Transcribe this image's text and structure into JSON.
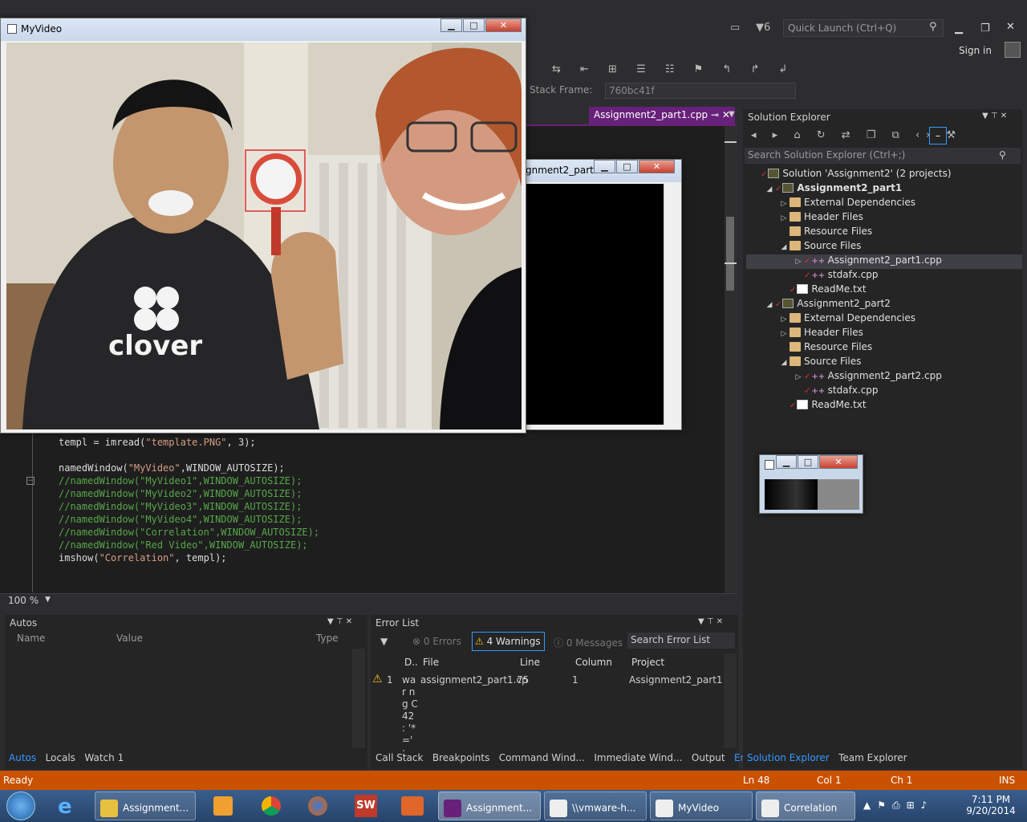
{
  "vs": {
    "quick_launch_placeholder": "Quick Launch (Ctrl+Q)",
    "notifications_count": "6",
    "sign_in": "Sign in",
    "stack_frame_label": "Stack Frame:",
    "stack_frame_value": "760bc41f",
    "doc_tab": "Assignment2_part1.cpp",
    "zoom": "100 %"
  },
  "code_lines": [
    {
      "text": "templ = imread(",
      "str": "\"template.PNG\"",
      "tail": ", 3);",
      "comment": false
    },
    {
      "text": "",
      "str": "",
      "tail": "",
      "comment": false
    },
    {
      "text": "namedWindow(",
      "str": "\"MyVideo\"",
      "tail": ",WINDOW_AUTOSIZE);",
      "comment": false
    },
    {
      "text": "//namedWindow(\"MyVideo1\",WINDOW_AUTOSIZE);",
      "str": "",
      "tail": "",
      "comment": true
    },
    {
      "text": "//namedWindow(\"MyVideo2\",WINDOW_AUTOSIZE);",
      "str": "",
      "tail": "",
      "comment": true
    },
    {
      "text": "//namedWindow(\"MyVideo3\",WINDOW_AUTOSIZE);",
      "str": "",
      "tail": "",
      "comment": true
    },
    {
      "text": "//namedWindow(\"MyVideo4\",WINDOW_AUTOSIZE);",
      "str": "",
      "tail": "",
      "comment": true
    },
    {
      "text": "//namedWindow(\"Correlation\",WINDOW_AUTOSIZE);",
      "str": "",
      "tail": "",
      "comment": true
    },
    {
      "text": "//namedWindow(\"Red Video\",WINDOW_AUTOSIZE);",
      "str": "",
      "tail": "",
      "comment": true
    },
    {
      "text": "imshow(",
      "str": "\"Correlation\"",
      "tail": ", templ);",
      "comment": false
    }
  ],
  "autos": {
    "title": "Autos",
    "columns": [
      "Name",
      "Value",
      "Type"
    ],
    "tabs": [
      "Autos",
      "Locals",
      "Watch 1"
    ]
  },
  "error_list": {
    "title": "Error List",
    "errors": "0 Errors",
    "warnings": "4 Warnings",
    "messages": "0 Messages",
    "search_placeholder": "Search Error List",
    "columns": [
      "D..",
      "File",
      "Line",
      "Column",
      "Project"
    ],
    "row": {
      "num": "1",
      "desc": "war ng C42 : '*=' :",
      "file": "assignment2_part1.cp",
      "line": "75",
      "column": "1",
      "project": "Assignment2_part1"
    },
    "tabs": [
      "Call Stack",
      "Breakpoints",
      "Command Wind...",
      "Immediate Wind...",
      "Output",
      "Error List"
    ]
  },
  "solution_explorer": {
    "title": "Solution Explorer",
    "search_placeholder": "Search Solution Explorer (Ctrl+;)",
    "items": [
      {
        "label": "Solution 'Assignment2' (2 projects)",
        "type": "solution"
      },
      {
        "label": "Assignment2_part1",
        "type": "project"
      },
      {
        "label": "External Dependencies",
        "type": "folder"
      },
      {
        "label": "Header Files",
        "type": "folder"
      },
      {
        "label": "Resource Files",
        "type": "folder"
      },
      {
        "label": "Source Files",
        "type": "folder"
      },
      {
        "label": "Assignment2_part1.cpp",
        "type": "cpp"
      },
      {
        "label": "stdafx.cpp",
        "type": "cpp"
      },
      {
        "label": "ReadMe.txt",
        "type": "txt"
      },
      {
        "label": "Assignment2_part2",
        "type": "project"
      },
      {
        "label": "External Dependencies",
        "type": "folder"
      },
      {
        "label": "Header Files",
        "type": "folder"
      },
      {
        "label": "Resource Files",
        "type": "folder"
      },
      {
        "label": "Source Files",
        "type": "folder"
      },
      {
        "label": "Assignment2_part2.cpp",
        "type": "cpp"
      },
      {
        "label": "stdafx.cpp",
        "type": "cpp"
      },
      {
        "label": "ReadMe.txt",
        "type": "txt"
      }
    ],
    "tabs": [
      "Solution Explorer",
      "Team Explorer"
    ]
  },
  "windows": {
    "myvideo_title": "MyVideo",
    "shirt_text": "clover",
    "second_title": "gnment2_part..."
  },
  "status": {
    "ready": "Ready",
    "ln": "Ln 48",
    "col": "Col 1",
    "ch": "Ch 1",
    "ins": "INS"
  },
  "taskbar": {
    "items": [
      "Assignment...",
      "Assignment...",
      "\\\\vmware-h...",
      "MyVideo",
      "Correlation"
    ],
    "time": "7:11 PM",
    "date": "9/20/2014"
  }
}
